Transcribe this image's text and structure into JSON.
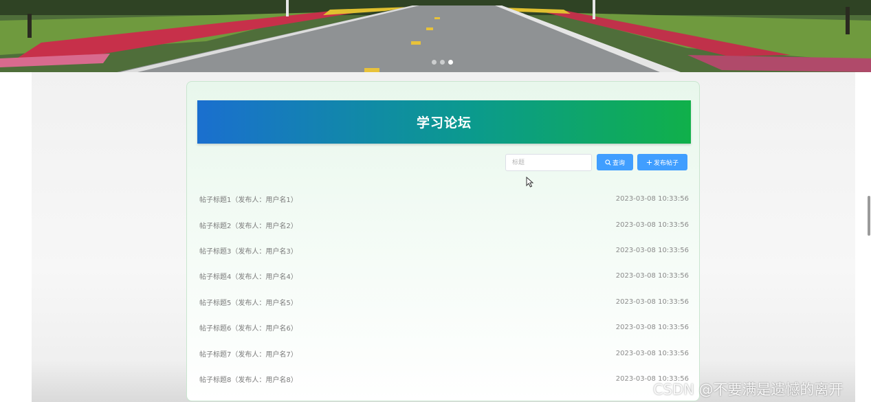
{
  "banner": {
    "carousel_dots": 3,
    "active_dot": 3
  },
  "forum": {
    "title": "学习论坛",
    "search_placeholder": "标题",
    "search_button": "查询",
    "post_button": "发布帖子",
    "posts": [
      {
        "title": "帖子标题1（发布人：用户名1）",
        "date": "2023-03-08 10:33:56"
      },
      {
        "title": "帖子标题2（发布人：用户名2）",
        "date": "2023-03-08 10:33:56"
      },
      {
        "title": "帖子标题3（发布人：用户名3）",
        "date": "2023-03-08 10:33:56"
      },
      {
        "title": "帖子标题4（发布人：用户名4）",
        "date": "2023-03-08 10:33:56"
      },
      {
        "title": "帖子标题5（发布人：用户名5）",
        "date": "2023-03-08 10:33:56"
      },
      {
        "title": "帖子标题6（发布人：用户名6）",
        "date": "2023-03-08 10:33:56"
      },
      {
        "title": "帖子标题7（发布人：用户名7）",
        "date": "2023-03-08 10:33:56"
      },
      {
        "title": "帖子标题8（发布人：用户名8）",
        "date": "2023-03-08 10:33:56"
      }
    ]
  },
  "colors": {
    "title_gradient_start": "#1a6fcf",
    "title_gradient_end": "#10b04a",
    "primary_button": "#409eff"
  },
  "watermark": "CSDN @不要满是遗憾的离开"
}
